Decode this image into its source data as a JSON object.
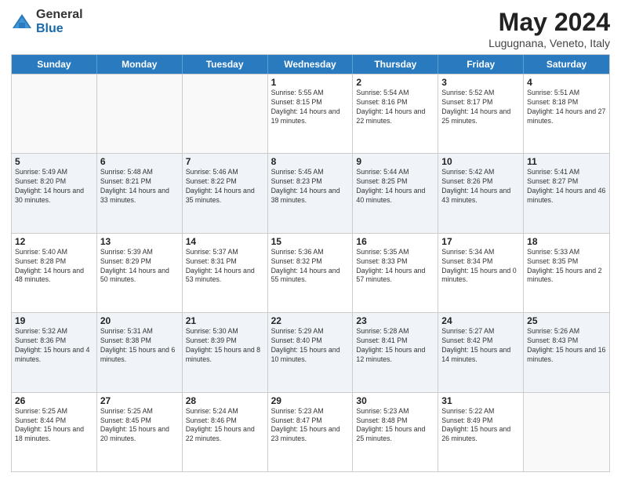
{
  "logo": {
    "general": "General",
    "blue": "Blue"
  },
  "title": "May 2024",
  "subtitle": "Lugugnana, Veneto, Italy",
  "header_days": [
    "Sunday",
    "Monday",
    "Tuesday",
    "Wednesday",
    "Thursday",
    "Friday",
    "Saturday"
  ],
  "rows": [
    [
      {
        "day": "",
        "sunrise": "",
        "sunset": "",
        "daylight": ""
      },
      {
        "day": "",
        "sunrise": "",
        "sunset": "",
        "daylight": ""
      },
      {
        "day": "",
        "sunrise": "",
        "sunset": "",
        "daylight": ""
      },
      {
        "day": "1",
        "sunrise": "Sunrise: 5:55 AM",
        "sunset": "Sunset: 8:15 PM",
        "daylight": "Daylight: 14 hours and 19 minutes."
      },
      {
        "day": "2",
        "sunrise": "Sunrise: 5:54 AM",
        "sunset": "Sunset: 8:16 PM",
        "daylight": "Daylight: 14 hours and 22 minutes."
      },
      {
        "day": "3",
        "sunrise": "Sunrise: 5:52 AM",
        "sunset": "Sunset: 8:17 PM",
        "daylight": "Daylight: 14 hours and 25 minutes."
      },
      {
        "day": "4",
        "sunrise": "Sunrise: 5:51 AM",
        "sunset": "Sunset: 8:18 PM",
        "daylight": "Daylight: 14 hours and 27 minutes."
      }
    ],
    [
      {
        "day": "5",
        "sunrise": "Sunrise: 5:49 AM",
        "sunset": "Sunset: 8:20 PM",
        "daylight": "Daylight: 14 hours and 30 minutes."
      },
      {
        "day": "6",
        "sunrise": "Sunrise: 5:48 AM",
        "sunset": "Sunset: 8:21 PM",
        "daylight": "Daylight: 14 hours and 33 minutes."
      },
      {
        "day": "7",
        "sunrise": "Sunrise: 5:46 AM",
        "sunset": "Sunset: 8:22 PM",
        "daylight": "Daylight: 14 hours and 35 minutes."
      },
      {
        "day": "8",
        "sunrise": "Sunrise: 5:45 AM",
        "sunset": "Sunset: 8:23 PM",
        "daylight": "Daylight: 14 hours and 38 minutes."
      },
      {
        "day": "9",
        "sunrise": "Sunrise: 5:44 AM",
        "sunset": "Sunset: 8:25 PM",
        "daylight": "Daylight: 14 hours and 40 minutes."
      },
      {
        "day": "10",
        "sunrise": "Sunrise: 5:42 AM",
        "sunset": "Sunset: 8:26 PM",
        "daylight": "Daylight: 14 hours and 43 minutes."
      },
      {
        "day": "11",
        "sunrise": "Sunrise: 5:41 AM",
        "sunset": "Sunset: 8:27 PM",
        "daylight": "Daylight: 14 hours and 46 minutes."
      }
    ],
    [
      {
        "day": "12",
        "sunrise": "Sunrise: 5:40 AM",
        "sunset": "Sunset: 8:28 PM",
        "daylight": "Daylight: 14 hours and 48 minutes."
      },
      {
        "day": "13",
        "sunrise": "Sunrise: 5:39 AM",
        "sunset": "Sunset: 8:29 PM",
        "daylight": "Daylight: 14 hours and 50 minutes."
      },
      {
        "day": "14",
        "sunrise": "Sunrise: 5:37 AM",
        "sunset": "Sunset: 8:31 PM",
        "daylight": "Daylight: 14 hours and 53 minutes."
      },
      {
        "day": "15",
        "sunrise": "Sunrise: 5:36 AM",
        "sunset": "Sunset: 8:32 PM",
        "daylight": "Daylight: 14 hours and 55 minutes."
      },
      {
        "day": "16",
        "sunrise": "Sunrise: 5:35 AM",
        "sunset": "Sunset: 8:33 PM",
        "daylight": "Daylight: 14 hours and 57 minutes."
      },
      {
        "day": "17",
        "sunrise": "Sunrise: 5:34 AM",
        "sunset": "Sunset: 8:34 PM",
        "daylight": "Daylight: 15 hours and 0 minutes."
      },
      {
        "day": "18",
        "sunrise": "Sunrise: 5:33 AM",
        "sunset": "Sunset: 8:35 PM",
        "daylight": "Daylight: 15 hours and 2 minutes."
      }
    ],
    [
      {
        "day": "19",
        "sunrise": "Sunrise: 5:32 AM",
        "sunset": "Sunset: 8:36 PM",
        "daylight": "Daylight: 15 hours and 4 minutes."
      },
      {
        "day": "20",
        "sunrise": "Sunrise: 5:31 AM",
        "sunset": "Sunset: 8:38 PM",
        "daylight": "Daylight: 15 hours and 6 minutes."
      },
      {
        "day": "21",
        "sunrise": "Sunrise: 5:30 AM",
        "sunset": "Sunset: 8:39 PM",
        "daylight": "Daylight: 15 hours and 8 minutes."
      },
      {
        "day": "22",
        "sunrise": "Sunrise: 5:29 AM",
        "sunset": "Sunset: 8:40 PM",
        "daylight": "Daylight: 15 hours and 10 minutes."
      },
      {
        "day": "23",
        "sunrise": "Sunrise: 5:28 AM",
        "sunset": "Sunset: 8:41 PM",
        "daylight": "Daylight: 15 hours and 12 minutes."
      },
      {
        "day": "24",
        "sunrise": "Sunrise: 5:27 AM",
        "sunset": "Sunset: 8:42 PM",
        "daylight": "Daylight: 15 hours and 14 minutes."
      },
      {
        "day": "25",
        "sunrise": "Sunrise: 5:26 AM",
        "sunset": "Sunset: 8:43 PM",
        "daylight": "Daylight: 15 hours and 16 minutes."
      }
    ],
    [
      {
        "day": "26",
        "sunrise": "Sunrise: 5:25 AM",
        "sunset": "Sunset: 8:44 PM",
        "daylight": "Daylight: 15 hours and 18 minutes."
      },
      {
        "day": "27",
        "sunrise": "Sunrise: 5:25 AM",
        "sunset": "Sunset: 8:45 PM",
        "daylight": "Daylight: 15 hours and 20 minutes."
      },
      {
        "day": "28",
        "sunrise": "Sunrise: 5:24 AM",
        "sunset": "Sunset: 8:46 PM",
        "daylight": "Daylight: 15 hours and 22 minutes."
      },
      {
        "day": "29",
        "sunrise": "Sunrise: 5:23 AM",
        "sunset": "Sunset: 8:47 PM",
        "daylight": "Daylight: 15 hours and 23 minutes."
      },
      {
        "day": "30",
        "sunrise": "Sunrise: 5:23 AM",
        "sunset": "Sunset: 8:48 PM",
        "daylight": "Daylight: 15 hours and 25 minutes."
      },
      {
        "day": "31",
        "sunrise": "Sunrise: 5:22 AM",
        "sunset": "Sunset: 8:49 PM",
        "daylight": "Daylight: 15 hours and 26 minutes."
      },
      {
        "day": "",
        "sunrise": "",
        "sunset": "",
        "daylight": ""
      }
    ]
  ]
}
